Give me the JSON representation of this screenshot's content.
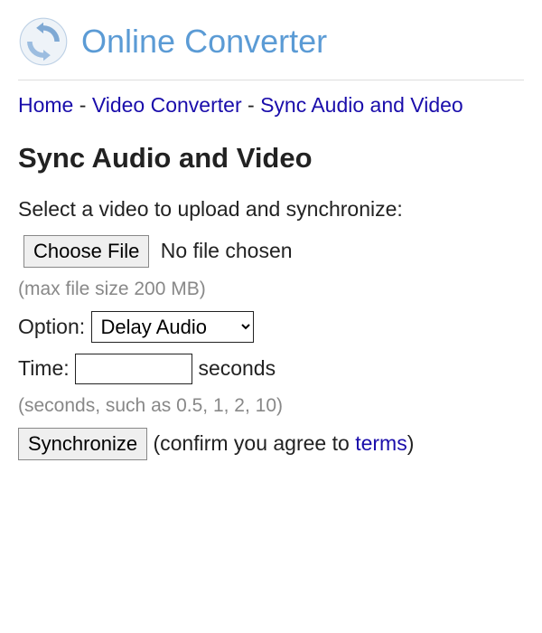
{
  "header": {
    "site_title": "Online Converter"
  },
  "breadcrumb": {
    "home": "Home",
    "video_converter": "Video Converter",
    "current": "Sync Audio and Video",
    "sep": " - "
  },
  "page": {
    "title": "Sync Audio and Video",
    "intro": "Select a video to upload and synchronize:"
  },
  "file": {
    "choose_label": "Choose File",
    "status": "No file chosen",
    "hint": "(max file size 200 MB)"
  },
  "option": {
    "label": "Option:",
    "selected": "Delay Audio"
  },
  "time": {
    "label": "Time:",
    "value": "",
    "unit": "seconds",
    "hint": "(seconds, such as 0.5, 1, 2, 10)"
  },
  "submit": {
    "button": "Synchronize",
    "confirm_prefix": "(confirm you agree to ",
    "terms": "terms",
    "confirm_suffix": ")"
  }
}
